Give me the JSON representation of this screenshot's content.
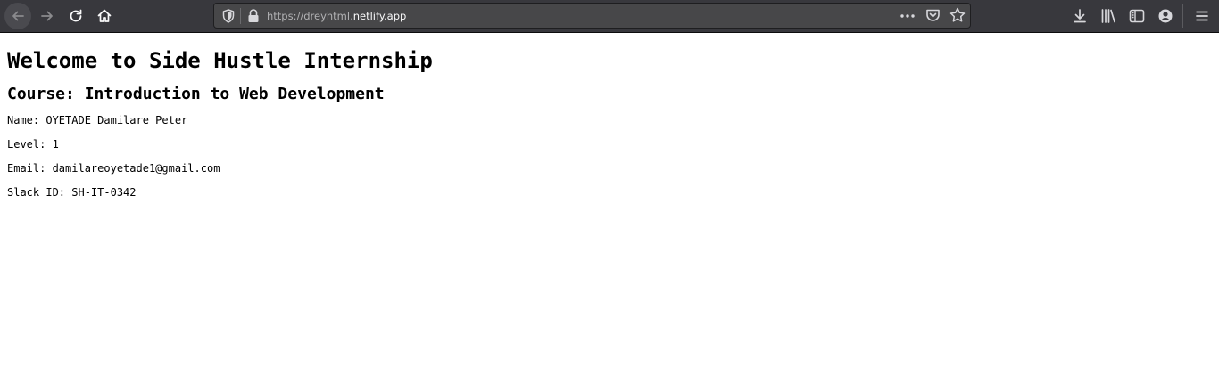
{
  "browser": {
    "url_prefix": "https://dreyhtml.",
    "url_domain": "netlify.app",
    "icons": [
      "back-arrow-icon",
      "forward-arrow-icon",
      "reload-icon",
      "home-icon",
      "shield-icon",
      "lock-icon",
      "more-icon",
      "pocket-icon",
      "star-icon",
      "download-icon",
      "library-icon",
      "sidebar-icon",
      "account-icon",
      "menu-icon"
    ],
    "colors": {
      "toolbar": "#38383d",
      "urlbar": "#474749",
      "icon": "#f9f9fa"
    }
  },
  "page": {
    "heading": "Welcome to Side Hustle Internship",
    "subheading": "Course: Introduction to Web Development",
    "details": [
      "Name: OYETADE Damilare Peter",
      "Level: 1",
      "Email: damilareoyetade1@gmail.com",
      "Slack ID: SH-IT-0342"
    ]
  }
}
